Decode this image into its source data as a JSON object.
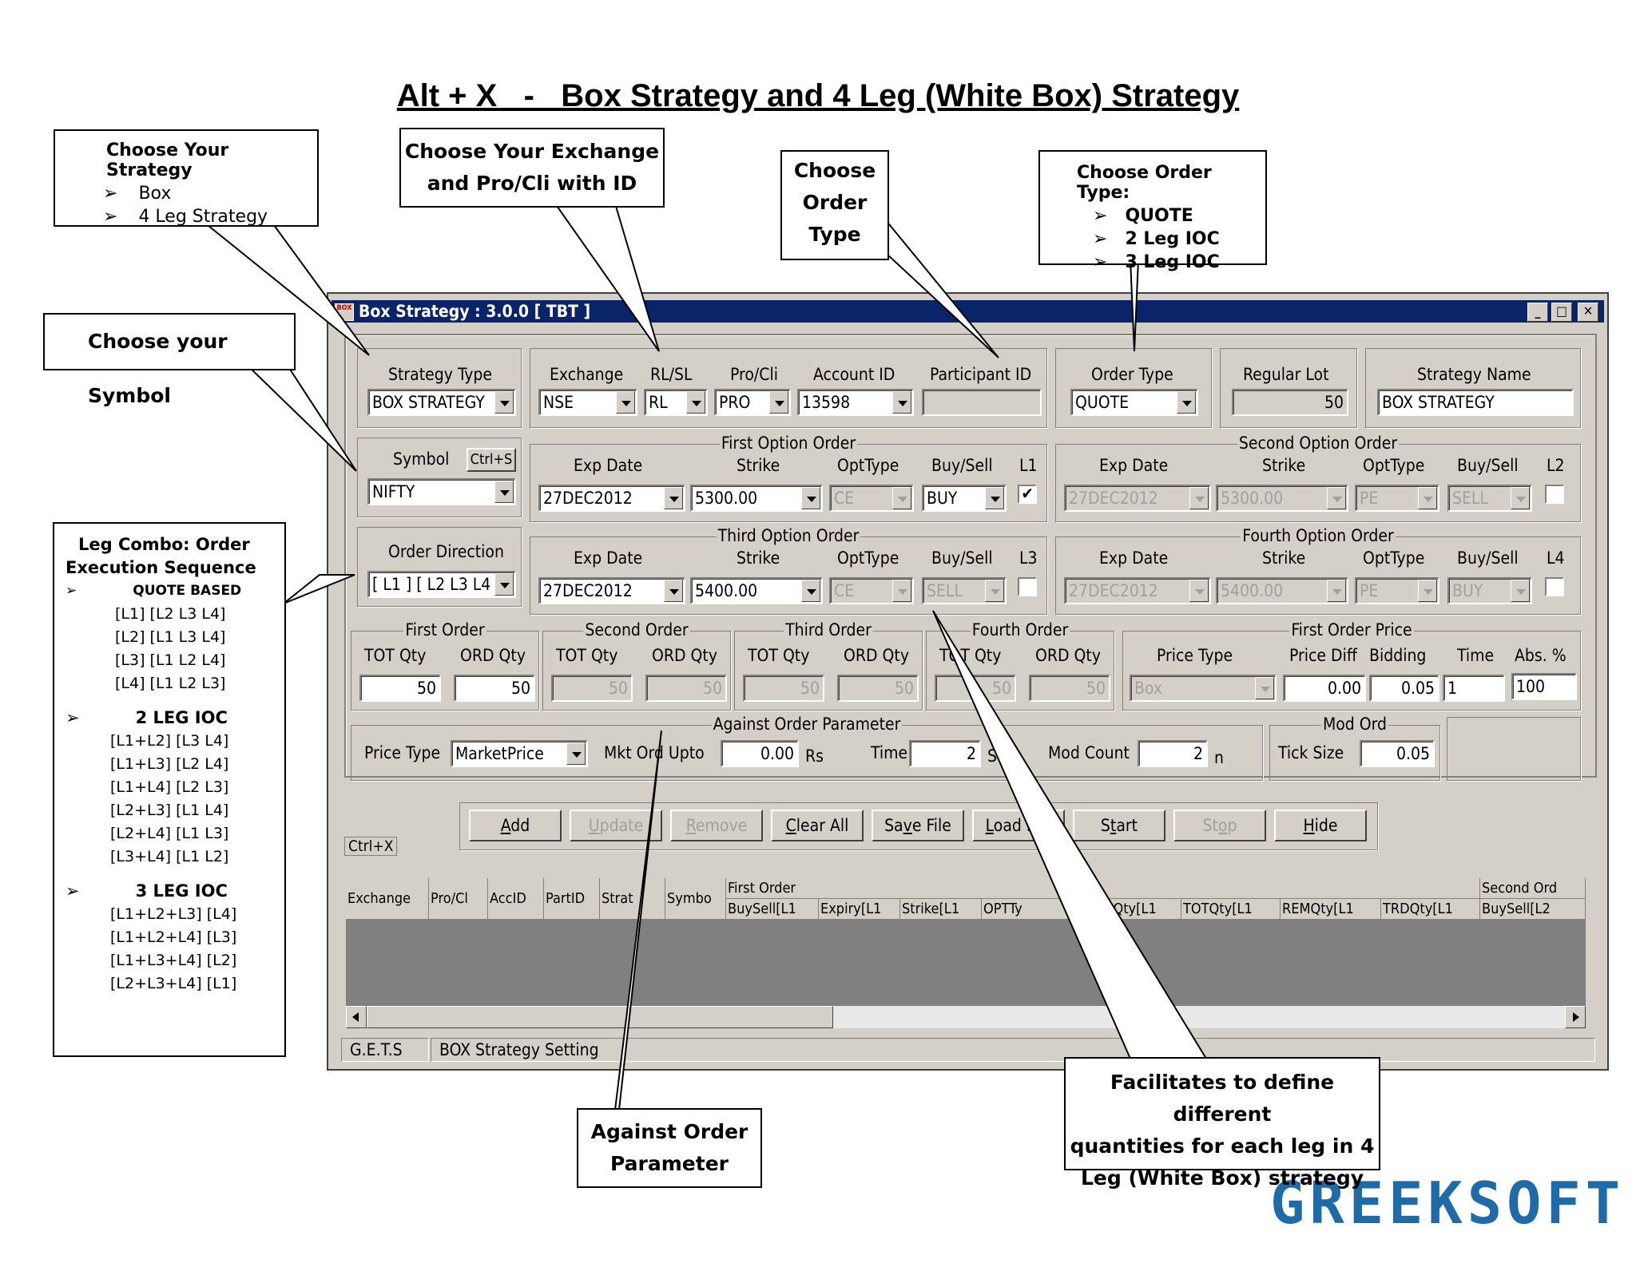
{
  "title": "Alt + X   -   Box Strategy and 4 Leg (White Box) Strategy",
  "callouts": {
    "strategy": {
      "title": "Choose Your Strategy",
      "items": [
        "Box",
        "4 Leg Strategy"
      ]
    },
    "exchange": {
      "line1": "Choose Your Exchange",
      "line2": "and Pro/Cli with ID"
    },
    "ordertype1": {
      "lines": [
        "Choose",
        "Order",
        "Type"
      ]
    },
    "ordertype2": {
      "title": "Choose Order Type:",
      "items": [
        "QUOTE",
        "2 Leg IOC",
        "3 Leg IOC"
      ]
    },
    "symbol": {
      "text": "Choose your Symbol"
    },
    "legcombo": {
      "title1": "Leg Combo: Order",
      "title2": "Execution Sequence",
      "sec1": "QUOTE BASED",
      "sec1_items": [
        "[L1] [L2 L3 L4]",
        "[L2] [L1 L3 L4]",
        "[L3] [L1 L2 L4]",
        "[L4] [L1 L2 L3]"
      ],
      "sec2": "2 LEG IOC",
      "sec2_items": [
        "[L1+L2]  [L3 L4]",
        "[L1+L3]  [L2 L4]",
        "[L1+L4]  [L2 L3]",
        "[L2+L3]  [L1 L4]",
        "[L2+L4]  [L1 L3]",
        "[L3+L4]  [L1 L2]"
      ],
      "sec3": "3 LEG IOC",
      "sec3_items": [
        "[L1+L2+L3] [L4]",
        "[L1+L2+L4] [L3]",
        "[L1+L3+L4] [L2]",
        "[L2+L3+L4] [L1]"
      ]
    },
    "against": {
      "line1": "Against Order",
      "line2": "Parameter"
    },
    "quantities": {
      "line1": "Facilitates to define different",
      "line2": "quantities for each leg in 4",
      "line3": "Leg (White Box) strategy"
    }
  },
  "window": {
    "title": "Box Strategy : 3.0.0  [ TBT ]",
    "icon_text": "BOX",
    "row1": {
      "strategy_type_label": "Strategy Type",
      "strategy_type": "BOX STRATEGY",
      "exchange_label": "Exchange",
      "exchange": "NSE",
      "rlsl_label": "RL/SL",
      "rlsl": "RL",
      "procli_label": "Pro/Cli",
      "procli": "PRO",
      "account_label": "Account ID",
      "account": "13598",
      "participant_label": "Participant ID",
      "participant": "",
      "order_type_label": "Order Type",
      "order_type": "QUOTE",
      "regular_lot_label": "Regular Lot",
      "regular_lot": "50",
      "strategy_name_label": "Strategy Name",
      "strategy_name": "BOX STRATEGY"
    },
    "symbol_label": "Symbol",
    "symbol_shortcut": "Ctrl+S",
    "symbol": "NIFTY",
    "order_direction_label": "Order Direction",
    "order_direction": "[ L1 ] [ L2 L3 L4 ]",
    "col_labels": {
      "exp": "Exp Date",
      "strike": "Strike",
      "opttype": "OptType",
      "buysell": "Buy/Sell"
    },
    "legs": [
      {
        "title": "First Option Order",
        "exp": "27DEC2012",
        "strike": "5300.00",
        "opttype": "CE",
        "buysell": "BUY",
        "tag": "L1",
        "checked": "✔"
      },
      {
        "title": "Second Option Order",
        "exp": "27DEC2012",
        "strike": "5300.00",
        "opttype": "PE",
        "buysell": "SELL",
        "tag": "L2",
        "checked": ""
      },
      {
        "title": "Third Option Order",
        "exp": "27DEC2012",
        "strike": "5400.00",
        "opttype": "CE",
        "buysell": "SELL",
        "tag": "L3",
        "checked": ""
      },
      {
        "title": "Fourth Option Order",
        "exp": "27DEC2012",
        "strike": "5400.00",
        "opttype": "PE",
        "buysell": "BUY",
        "tag": "L4",
        "checked": ""
      }
    ],
    "qty_groups": [
      {
        "title": "First Order",
        "tot_label": "TOT Qty",
        "ord_label": "ORD Qty",
        "tot": "50",
        "ord": "50"
      },
      {
        "title": "Second Order",
        "tot_label": "TOT Qty",
        "ord_label": "ORD Qty",
        "tot": "50",
        "ord": "50"
      },
      {
        "title": "Third Order",
        "tot_label": "TOT Qty",
        "ord_label": "ORD Qty",
        "tot": "50",
        "ord": "50"
      },
      {
        "title": "Fourth Order",
        "tot_label": "TOT Qty",
        "ord_label": "ORD Qty",
        "tot": "50",
        "ord": "50"
      }
    ],
    "first_order_price": {
      "title": "First Order Price",
      "price_type_label": "Price Type",
      "price_type": "Box",
      "price_diff_label": "Price Diff",
      "price_diff": "0.00",
      "bidding_label": "Bidding",
      "bidding": "0.05",
      "time_label": "Time",
      "time": "1",
      "abs_label": "Abs. %",
      "abs": "100"
    },
    "against_order": {
      "title": "Against Order Parameter",
      "price_type_label": "Price Type",
      "price_type": "MarketPrice",
      "mkt_label": "Mkt Ord Upto",
      "mkt": "0.00",
      "mkt_unit": "Rs",
      "time_label": "Time",
      "time": "2",
      "time_unit": "Se",
      "mod_count_label": "Mod Count",
      "mod_count": "2",
      "mod_count_unit": "n"
    },
    "mod_ord": {
      "title": "Mod Ord",
      "tick_label": "Tick Size",
      "tick": "0.05"
    },
    "ctrlx": "Ctrl+X",
    "buttons": [
      {
        "label": "Add",
        "u": "A",
        "rest": "dd",
        "enabled": true
      },
      {
        "label": "Update",
        "u": "U",
        "rest": "pdate",
        "enabled": false
      },
      {
        "label": "Remove",
        "u": "R",
        "rest": "emove",
        "enabled": false
      },
      {
        "label": "Clear All",
        "u": "C",
        "rest": "lear All",
        "enabled": true
      },
      {
        "label": "Save File",
        "pre": "Sa",
        "u": "v",
        "rest": "e File",
        "enabled": true
      },
      {
        "label": "Load File",
        "u": "L",
        "rest": "oad File",
        "enabled": true
      },
      {
        "label": "Start",
        "pre": "S",
        "u": "t",
        "rest": "art",
        "enabled": true
      },
      {
        "label": "Stop",
        "pre": "St",
        "u": "o",
        "rest": "p",
        "enabled": false
      },
      {
        "label": "Hide",
        "u": "H",
        "rest": "ide",
        "enabled": true
      }
    ],
    "grid_headers": [
      "Exchange",
      "Pro/Cl",
      "AccID",
      "PartID",
      "Strat",
      "Symbo"
    ],
    "grid_group1": "First Order",
    "grid_group2": "Second Ord",
    "grid_subheaders": [
      "BuySell[L1",
      "Expiry[L1",
      "Strike[L1",
      "OPTTy",
      "ORDQty[L1",
      "TOTQty[L1",
      "REMQty[L1",
      "TRDQty[L1",
      "BuySell[L2"
    ],
    "status": {
      "left": "G.E.T.S",
      "right": "BOX Strategy Setting"
    }
  },
  "logo": "GREEKSOFT",
  "colors": {
    "titlebar": "#0a246a",
    "window": "#d4d0c8",
    "logo": "#1f6aa8"
  }
}
